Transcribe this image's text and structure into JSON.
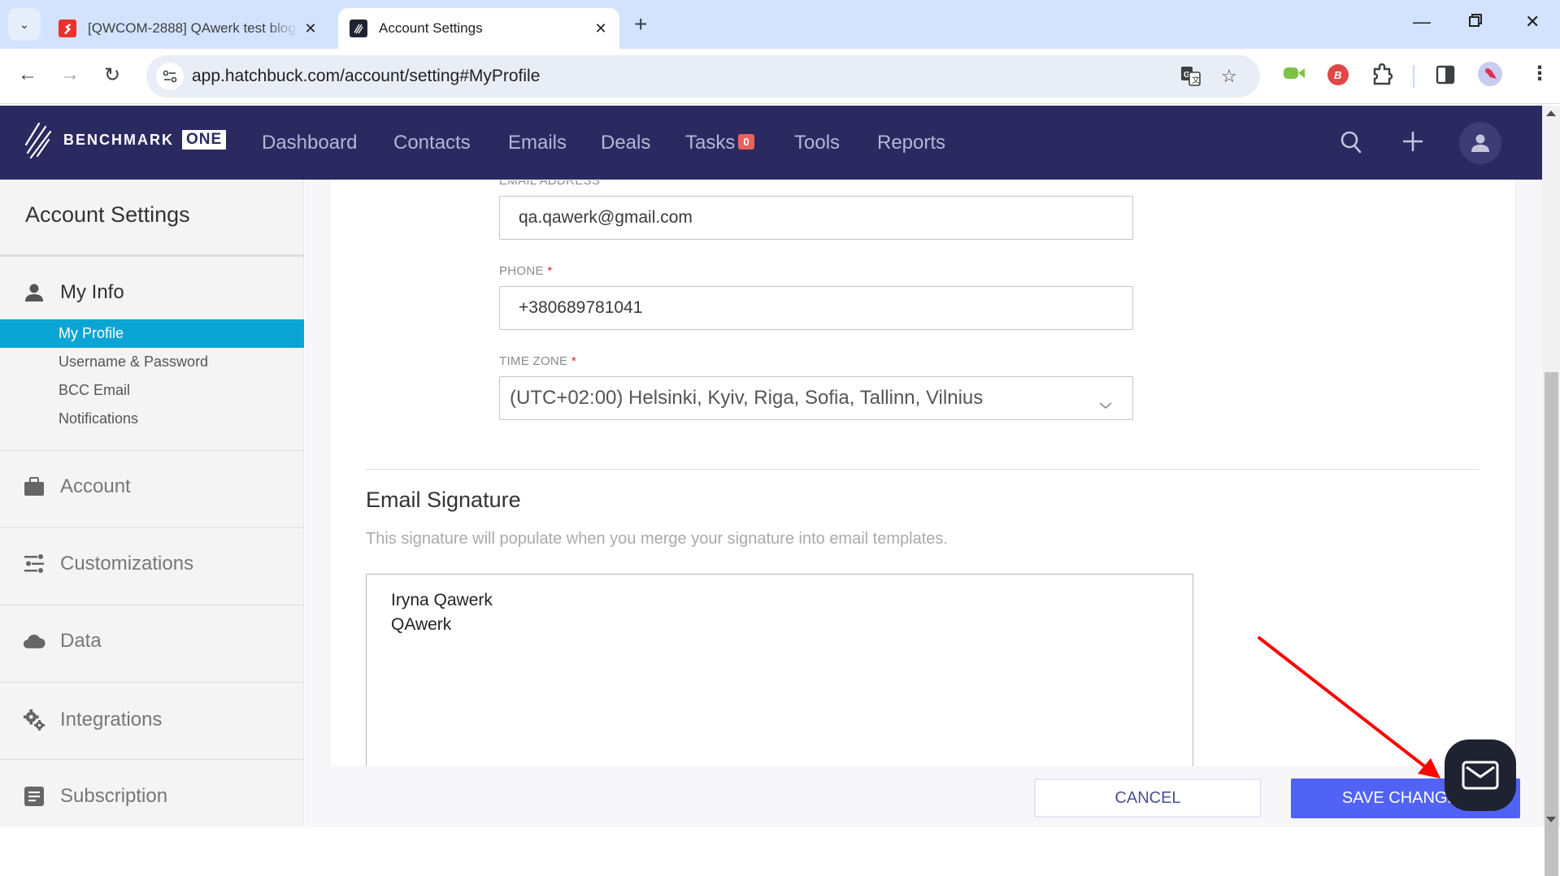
{
  "browser": {
    "tabs": [
      {
        "title": "[QWCOM-2888] QAwerk test blog",
        "active": false,
        "favicon": "jira-red-icon"
      },
      {
        "title": "Account Settings",
        "active": true,
        "favicon": "benchmark-icon"
      }
    ],
    "url": "app.hatchbuck.com/account/setting#MyProfile",
    "window_controls": [
      "minimize",
      "restore",
      "close"
    ],
    "extensions": [
      "green-camera-extension",
      "benchmark-email-extension",
      "extensions-puzzle",
      "side-panel",
      "profile-avatar",
      "menu"
    ]
  },
  "app": {
    "logo_text": "BENCHMARK",
    "logo_badge": "ONE",
    "nav": [
      {
        "label": "Dashboard"
      },
      {
        "label": "Contacts"
      },
      {
        "label": "Emails"
      },
      {
        "label": "Deals"
      },
      {
        "label": "Tasks",
        "badge": "0"
      },
      {
        "label": "Tools"
      },
      {
        "label": "Reports"
      }
    ],
    "colors": {
      "nav_bg": "#2b2a60",
      "active_item": "#0aa5d4",
      "primary_button": "#5163f4",
      "badge": "#e8645a"
    }
  },
  "sidebar": {
    "title": "Account Settings",
    "groups": [
      {
        "label": "My Info",
        "icon": "person-icon",
        "items": [
          {
            "label": "My Profile",
            "active": true
          },
          {
            "label": "Username & Password"
          },
          {
            "label": "BCC Email"
          },
          {
            "label": "Notifications"
          }
        ]
      },
      {
        "label": "Account",
        "icon": "briefcase-icon"
      },
      {
        "label": "Customizations",
        "icon": "sliders-icon"
      },
      {
        "label": "Data",
        "icon": "cloud-icon"
      },
      {
        "label": "Integrations",
        "icon": "gears-icon"
      },
      {
        "label": "Subscription",
        "icon": "document-icon"
      }
    ]
  },
  "form": {
    "email": {
      "label": "EMAIL ADDRESS",
      "value": "qa.qawerk@gmail.com"
    },
    "phone": {
      "label": "PHONE",
      "required": "*",
      "value": "+380689781041"
    },
    "timezone": {
      "label": "TIME ZONE",
      "required": "*",
      "value": "(UTC+02:00) Helsinki, Kyiv, Riga, Sofia, Tallinn, Vilnius"
    },
    "signature": {
      "title": "Email Signature",
      "description": "This signature will populate when you merge your signature into email templates.",
      "lines": [
        "Iryna Qawerk",
        "QAwerk"
      ]
    }
  },
  "actions": {
    "cancel": "CANCEL",
    "save": "SAVE CHANGES"
  }
}
